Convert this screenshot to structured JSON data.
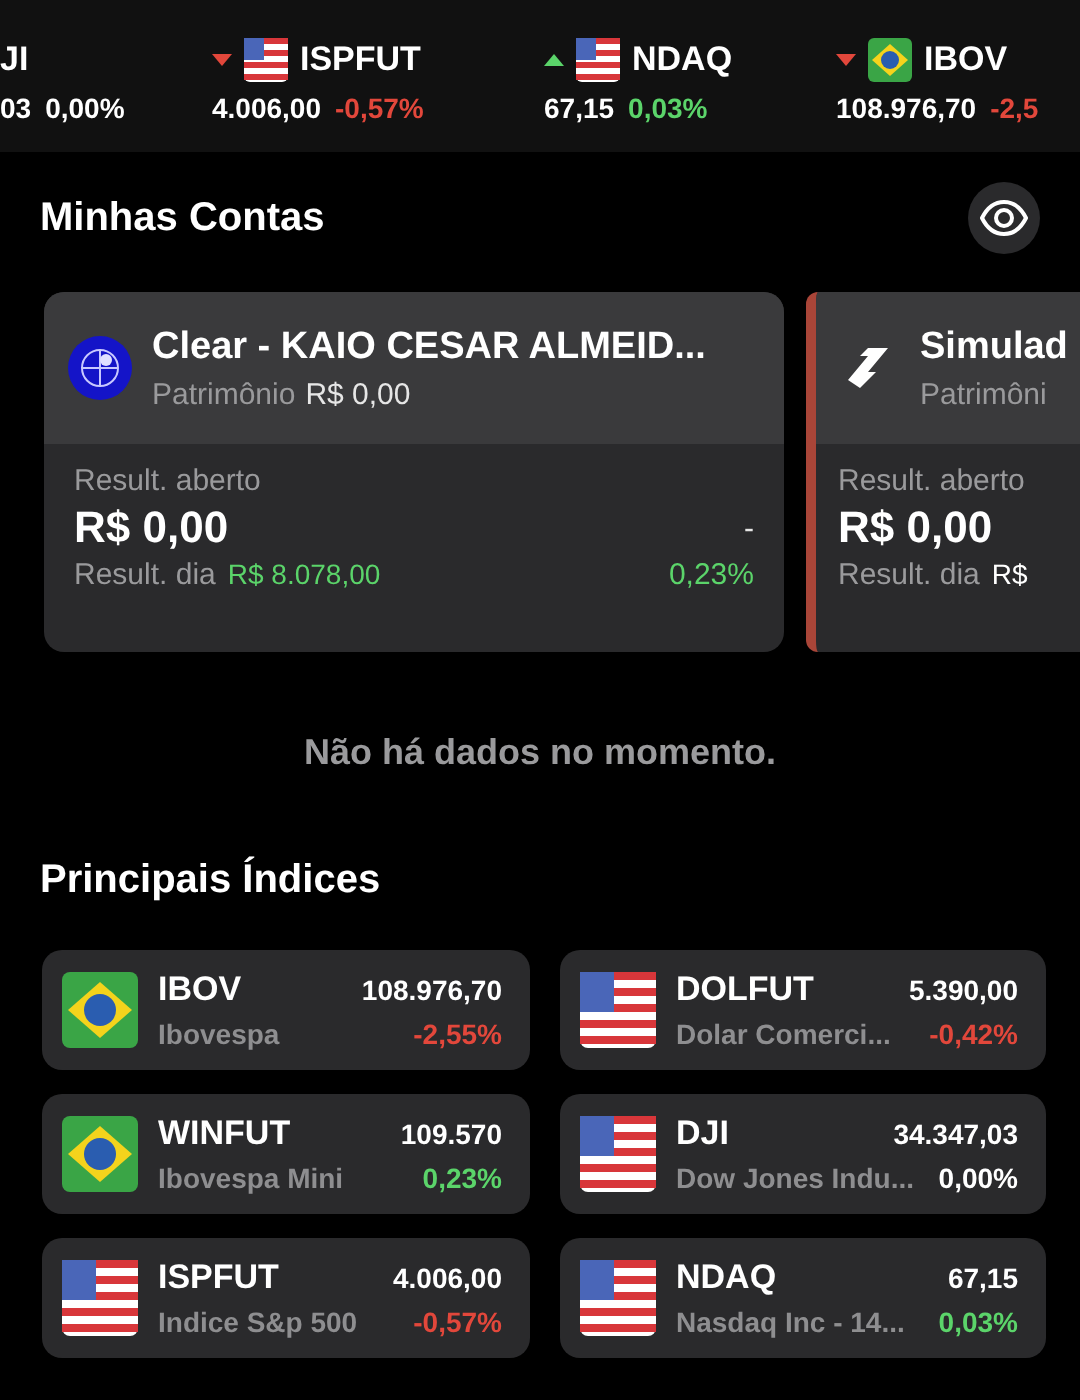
{
  "ticker": [
    {
      "symbol": "JI",
      "value": "03",
      "change": "0,00%",
      "color": "#ffffff"
    },
    {
      "kind": "us",
      "arrow_up": false,
      "symbol": "ISPFUT",
      "value": "4.006,00",
      "change": "-0,57%",
      "color": "#e2473b"
    },
    {
      "kind": "us",
      "arrow_up": true,
      "symbol": "NDAQ",
      "value": "67,15",
      "change": "0,03%",
      "color": "#5bd46a"
    },
    {
      "kind": "br",
      "arrow_up": false,
      "symbol": "IBOV",
      "value": "108.976,70",
      "change": "-2,5",
      "color": "#e2473b"
    }
  ],
  "accounts_title": "Minhas Contas",
  "accounts": [
    {
      "kind": "globe",
      "name": "Clear - KAIO CESAR ALMEID...",
      "equity_label": "Patrimônio",
      "equity_value": "R$ 0,00",
      "open_label": "Result. aberto",
      "open_value": "R$ 0,00",
      "open_pct": "-",
      "day_label": "Result. dia",
      "day_value": "R$ 8.078,00",
      "day_pct": "0,23%",
      "accent": false
    },
    {
      "kind": "bolt",
      "name": "Simulad",
      "equity_label": "Patrimôni",
      "open_label": "Result. aberto",
      "open_value": "R$ 0,00",
      "day_label": "Result. dia",
      "day_value": "R$",
      "accent": true
    }
  ],
  "empty_message": "Não há dados no momento.",
  "indices_title": "Principais Índices",
  "indices": [
    {
      "kind": "br",
      "symbol": "IBOV",
      "price": "108.976,70",
      "name": "Ibovespa",
      "change": "-2,55%",
      "color": "#e2473b"
    },
    {
      "kind": "us",
      "symbol": "DOLFUT",
      "price": "5.390,00",
      "name": "Dolar Comerci...",
      "change": "-0,42%",
      "color": "#e2473b"
    },
    {
      "kind": "br",
      "symbol": "WINFUT",
      "price": "109.570",
      "name": "Ibovespa Mini",
      "change": "0,23%",
      "color": "#5bd46a"
    },
    {
      "kind": "us",
      "symbol": "DJI",
      "price": "34.347,03",
      "name": "Dow Jones Indu...",
      "change": "0,00%",
      "color": "#ffffff"
    },
    {
      "kind": "us",
      "symbol": "ISPFUT",
      "price": "4.006,00",
      "name": "Indice S&p 500",
      "change": "-0,57%",
      "color": "#e2473b"
    },
    {
      "kind": "us",
      "symbol": "NDAQ",
      "price": "67,15",
      "name": "Nasdaq Inc - 14...",
      "change": "0,03%",
      "color": "#5bd46a"
    }
  ]
}
